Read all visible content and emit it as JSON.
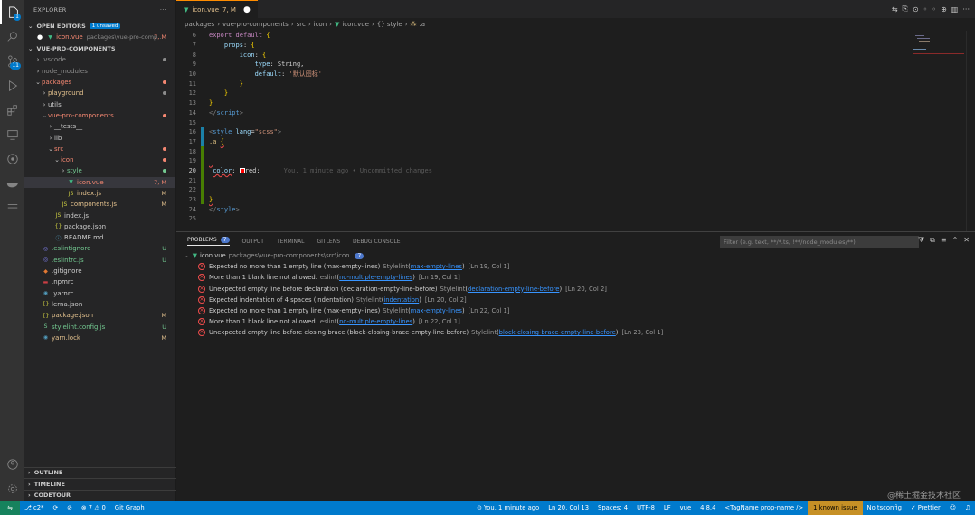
{
  "sidebar": {
    "title": "EXPLORER",
    "open_editors": {
      "label": "OPEN EDITORS",
      "badge": "1 unsaved"
    },
    "open_file": {
      "name": "icon.vue",
      "path": "packages\\vue-pro-comp...",
      "status": "7, M"
    },
    "workspace": "VUE-PRO-COMPONENTS",
    "tree": [
      {
        "name": ".vscode",
        "depth": 1,
        "kind": "folder",
        "open": false,
        "color": "grey",
        "status": "dot-grey"
      },
      {
        "name": "node_modules",
        "depth": 1,
        "kind": "folder",
        "open": false,
        "color": "grey",
        "status": ""
      },
      {
        "name": "packages",
        "depth": 1,
        "kind": "folder",
        "open": true,
        "color": "err",
        "status": "dot-err"
      },
      {
        "name": "playground",
        "depth": 2,
        "kind": "folder",
        "open": false,
        "color": "mod",
        "status": "dot-grey"
      },
      {
        "name": "utils",
        "depth": 2,
        "kind": "folder",
        "open": false,
        "color": "white",
        "status": ""
      },
      {
        "name": "vue-pro-components",
        "depth": 2,
        "kind": "folder",
        "open": true,
        "color": "err",
        "status": "dot-err"
      },
      {
        "name": "__tests__",
        "depth": 3,
        "kind": "folder",
        "open": false,
        "color": "white",
        "status": ""
      },
      {
        "name": "lib",
        "depth": 3,
        "kind": "folder",
        "open": false,
        "color": "white",
        "status": ""
      },
      {
        "name": "src",
        "depth": 3,
        "kind": "folder",
        "open": true,
        "color": "err",
        "status": "dot-err"
      },
      {
        "name": "icon",
        "depth": 4,
        "kind": "folder",
        "open": true,
        "color": "err",
        "status": "dot-err"
      },
      {
        "name": "style",
        "depth": 5,
        "kind": "folder",
        "open": false,
        "color": "un",
        "status": "dot-un"
      },
      {
        "name": "icon.vue",
        "depth": 5,
        "kind": "vue",
        "open": false,
        "color": "err",
        "status": "7, M",
        "selected": true
      },
      {
        "name": "index.js",
        "depth": 5,
        "kind": "js",
        "open": false,
        "color": "mod",
        "status": "M"
      },
      {
        "name": "components.js",
        "depth": 4,
        "kind": "js",
        "open": false,
        "color": "mod",
        "status": "M"
      },
      {
        "name": "index.js",
        "depth": 3,
        "kind": "js",
        "open": false,
        "color": "white",
        "status": ""
      },
      {
        "name": "package.json",
        "depth": 3,
        "kind": "json",
        "open": false,
        "color": "white",
        "status": ""
      },
      {
        "name": "README.md",
        "depth": 3,
        "kind": "info",
        "open": false,
        "color": "white",
        "status": ""
      },
      {
        "name": ".eslintignore",
        "depth": 1,
        "kind": "eslint",
        "open": false,
        "color": "un",
        "status": "U"
      },
      {
        "name": ".eslintrc.js",
        "depth": 1,
        "kind": "eslint",
        "open": false,
        "color": "un",
        "status": "U"
      },
      {
        "name": ".gitignore",
        "depth": 1,
        "kind": "git",
        "open": false,
        "color": "white",
        "status": ""
      },
      {
        "name": ".npmrc",
        "depth": 1,
        "kind": "npm",
        "open": false,
        "color": "white",
        "status": ""
      },
      {
        "name": ".yarnrc",
        "depth": 1,
        "kind": "yarn",
        "open": false,
        "color": "white",
        "status": ""
      },
      {
        "name": "lerna.json",
        "depth": 1,
        "kind": "json",
        "open": false,
        "color": "white",
        "status": ""
      },
      {
        "name": "package.json",
        "depth": 1,
        "kind": "json",
        "open": false,
        "color": "mod",
        "status": "M"
      },
      {
        "name": "stylelint.config.js",
        "depth": 1,
        "kind": "stylelint",
        "open": false,
        "color": "un",
        "status": "U"
      },
      {
        "name": "yarn.lock",
        "depth": 1,
        "kind": "yarn",
        "open": false,
        "color": "mod",
        "status": "M"
      }
    ],
    "bottom_sections": [
      "OUTLINE",
      "TIMELINE",
      "CODETOUR"
    ]
  },
  "editor": {
    "tab": {
      "name": "icon.vue",
      "status": "7, M"
    },
    "breadcrumb": [
      "packages",
      "vue-pro-components",
      "src",
      "icon",
      "icon.vue",
      "{} style",
      ".a"
    ],
    "lines": [
      {
        "n": "6",
        "gut": "",
        "html": "<span class='k'>export</span> <span class='k'>default</span> <span class='b'>{</span>"
      },
      {
        "n": "7",
        "gut": "",
        "html": "    <span class='p'>props</span>: <span class='b'>{</span>"
      },
      {
        "n": "8",
        "gut": "",
        "html": "        <span class='p'>icon</span>: <span class='b'>{</span>"
      },
      {
        "n": "9",
        "gut": "",
        "html": "            <span class='p'>type</span>: <span class='w'>String</span>,"
      },
      {
        "n": "10",
        "gut": "",
        "html": "            <span class='p'>default</span>: <span class='s'>'默认图标'</span>"
      },
      {
        "n": "11",
        "gut": "",
        "html": "        <span class='b'>}</span>"
      },
      {
        "n": "12",
        "gut": "",
        "html": "    <span class='b'>}</span>"
      },
      {
        "n": "13",
        "gut": "",
        "html": "<span class='b'>}</span>"
      },
      {
        "n": "14",
        "gut": "",
        "html": "<span class='t'>&lt;/</span><span class='tg'>script</span><span class='t'>&gt;</span>"
      },
      {
        "n": "15",
        "gut": "",
        "html": ""
      },
      {
        "n": "16",
        "gut": "mod",
        "html": "<span class='t'>&lt;</span><span class='tg'>style</span> <span class='p'>lang</span>=<span class='s'>\"scss\"</span><span class='t'>&gt;</span>"
      },
      {
        "n": "17",
        "gut": "mod",
        "html": "<span class='sel'>.a</span> <span class='b squig'>{</span>"
      },
      {
        "n": "18",
        "gut": "add",
        "html": ""
      },
      {
        "n": "19",
        "gut": "add",
        "html": "<span class='squig'> </span>"
      },
      {
        "n": "20",
        "gut": "add",
        "html": " <span class='p squig'>color</span>: <span style='display:inline-block;width:6px;height:6px;background:#ff0000;border:1px solid #fff;vertical-align:middle'></span><span class='w'>red</span>;",
        "blame": true,
        "current": true
      },
      {
        "n": "21",
        "gut": "add",
        "html": ""
      },
      {
        "n": "22",
        "gut": "add",
        "html": ""
      },
      {
        "n": "23",
        "gut": "add",
        "html": "<span class='b squig'>}</span>"
      },
      {
        "n": "24",
        "gut": "",
        "html": "<span class='t'>&lt;/</span><span class='tg'>style</span><span class='t'>&gt;</span>"
      },
      {
        "n": "25",
        "gut": "",
        "html": ""
      }
    ],
    "blame": "You, 1 minute ago • Uncommitted changes"
  },
  "panel": {
    "tabs": [
      "PROBLEMS",
      "OUTPUT",
      "TERMINAL",
      "GITLENS",
      "DEBUG CONSOLE"
    ],
    "problems_count": "7",
    "filter_placeholder": "Filter (e.g. text, **/*.ts, !**/node_modules/**)",
    "file": {
      "name": "icon.vue",
      "path": "packages\\vue-pro-components\\src\\icon",
      "count": "7"
    },
    "problems": [
      {
        "msg": "Expected no more than 1 empty line (max-empty-lines)",
        "source": "Stylelint",
        "code": "max-empty-lines",
        "pos": "[Ln 19, Col 1]"
      },
      {
        "msg": "More than 1 blank line not allowed.",
        "source": "eslint",
        "code": "no-multiple-empty-lines",
        "pos": "[Ln 19, Col 1]"
      },
      {
        "msg": "Unexpected empty line before declaration (declaration-empty-line-before)",
        "source": "Stylelint",
        "code": "declaration-empty-line-before",
        "pos": "[Ln 20, Col 2]"
      },
      {
        "msg": "Expected indentation of 4 spaces (indentation)",
        "source": "Stylelint",
        "code": "indentation",
        "pos": "[Ln 20, Col 2]"
      },
      {
        "msg": "Expected no more than 1 empty line (max-empty-lines)",
        "source": "Stylelint",
        "code": "max-empty-lines",
        "pos": "[Ln 22, Col 1]"
      },
      {
        "msg": "More than 1 blank line not allowed.",
        "source": "eslint",
        "code": "no-multiple-empty-lines",
        "pos": "[Ln 22, Col 1]"
      },
      {
        "msg": "Unexpected empty line before closing brace (block-closing-brace-empty-line-before)",
        "source": "Stylelint",
        "code": "block-closing-brace-empty-line-before",
        "pos": "[Ln 23, Col 1]"
      }
    ]
  },
  "statusbar": {
    "branch": "c2*",
    "problems": "⊗ 7 ⚠ 0",
    "git_graph": "Git Graph",
    "blame": "You, 1 minute ago",
    "position": "Ln 20, Col 13",
    "spaces": "Spaces: 4",
    "encoding": "UTF-8",
    "eol": "LF",
    "language": "vue",
    "ts_version": "4.8.4",
    "tag": "<TagName prop-name />",
    "known_issue": "1 known issue",
    "tsconfig": "No tsconfig",
    "prettier": "✓ Prettier"
  },
  "watermark": "@稀土掘金技术社区",
  "colors": {
    "accent": "#007acc",
    "error": "#f14c4c",
    "modified": "#e2c08d",
    "untracked": "#73c991"
  }
}
